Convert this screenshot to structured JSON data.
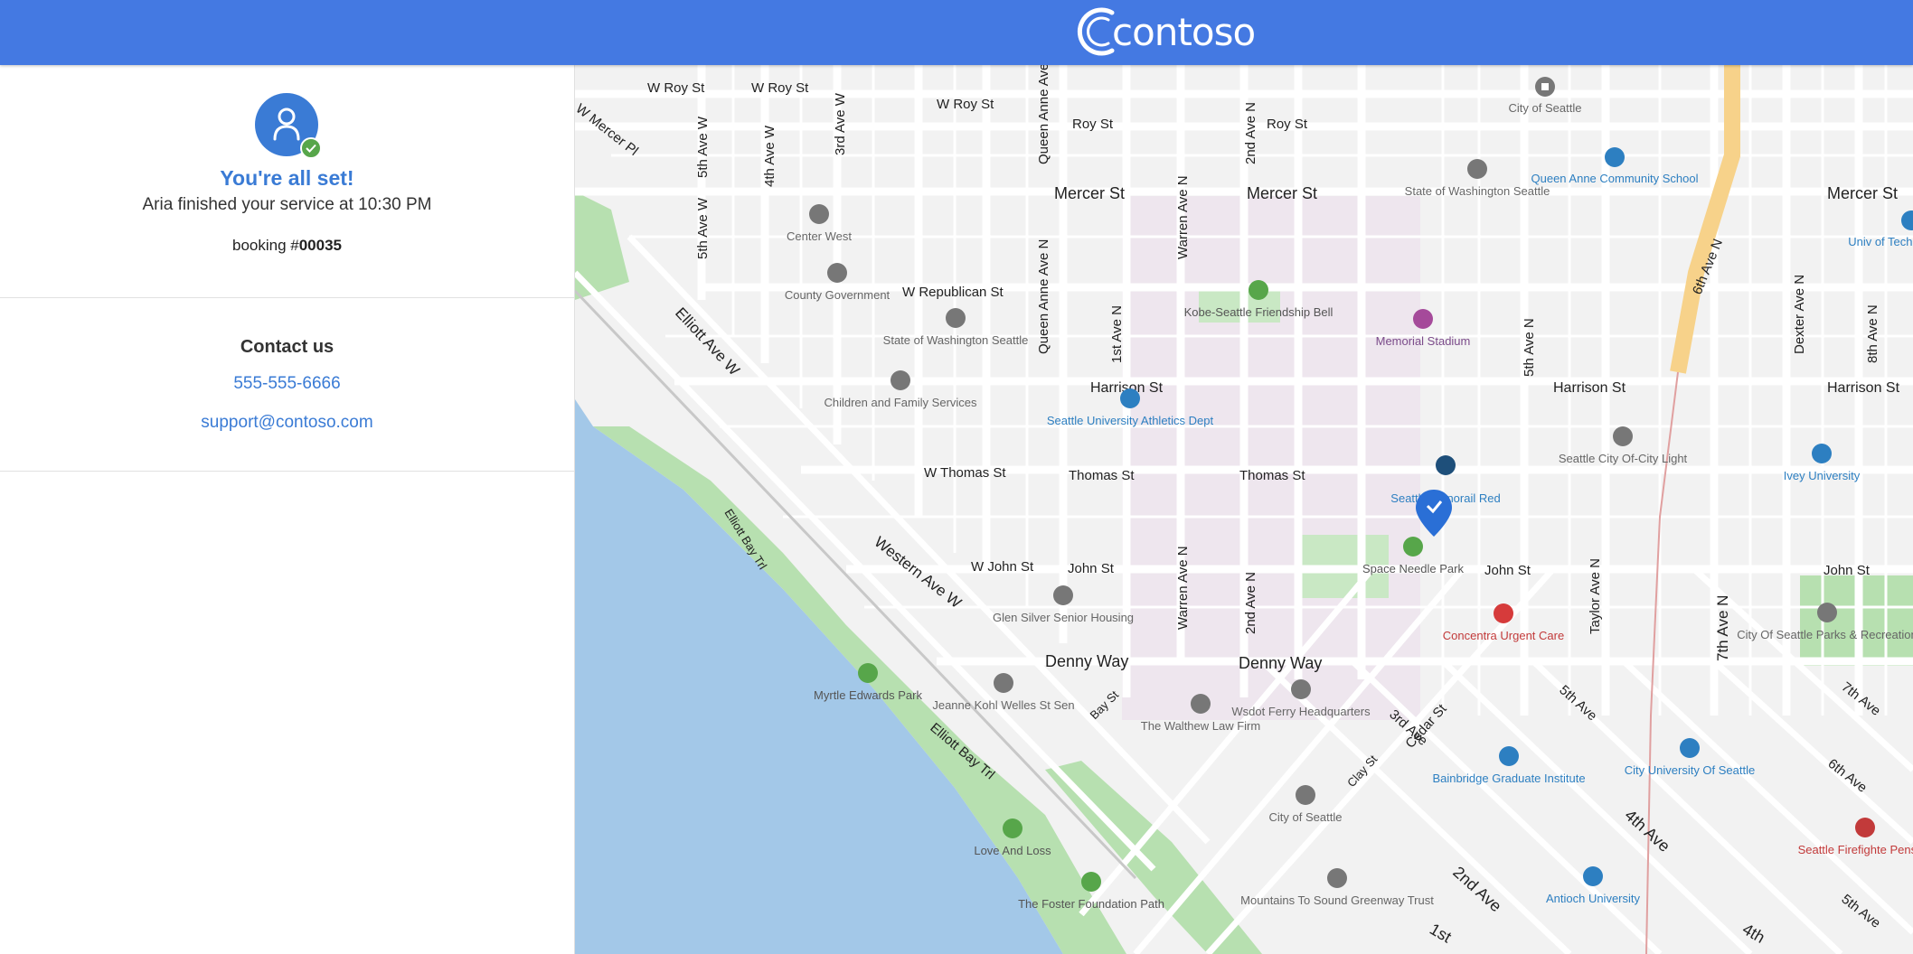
{
  "header": {
    "brand": "contoso",
    "brand_color": "#4479e2",
    "logo_icon": "contoso-logo-icon"
  },
  "status": {
    "avatar_icon": "person-icon",
    "badge_icon": "check-icon",
    "title": "You're all set!",
    "message": "Aria finished your service at 10:30 PM",
    "booking_prefix": "booking #",
    "booking_number": "00035"
  },
  "contact": {
    "title": "Contact us",
    "phone": "555-555-6666",
    "email": "support@contoso.com"
  },
  "map": {
    "streets": [
      "W Roy St",
      "W Roy St",
      "W Roy St",
      "Roy St",
      "Roy St",
      "W Mercer Pl",
      "Mercer St",
      "Mercer St",
      "Mercer St",
      "5th Ave W",
      "5th Ave W",
      "4th Ave W",
      "3rd Ave W",
      "Queen Anne Ave N",
      "Queen Anne Ave N",
      "Warren Ave N",
      "Warren Ave N",
      "2nd Ave N",
      "2nd Ave N",
      "1st Ave N",
      "5th Ave N",
      "6th Ave N",
      "Dexter Ave N",
      "8th Ave N",
      "Taylor Ave N",
      "7th Ave N",
      "W Republican St",
      "Harrison St",
      "Harrison St",
      "Harrison St",
      "W Thomas St",
      "Thomas St",
      "Thomas St",
      "W John St",
      "John St",
      "John St",
      "John St",
      "Denny Way",
      "Denny Way",
      "Elliott Ave W",
      "Western Ave W",
      "Elliott Bay Trl",
      "Elliott Bay Trl",
      "Bay St",
      "Clay St",
      "3rd Ave",
      "Cedar St",
      "5th Ave",
      "4th Ave",
      "2nd Ave",
      "1st",
      "4th",
      "7th Ave",
      "6th Ave",
      "5th Ave"
    ],
    "places": [
      {
        "name": "City of Seattle",
        "kind": "building"
      },
      {
        "name": "Queen Anne Community School",
        "kind": "school"
      },
      {
        "name": "State of Washington Seattle",
        "kind": "building"
      },
      {
        "name": "Center West",
        "kind": "building"
      },
      {
        "name": "County Government",
        "kind": "building"
      },
      {
        "name": "State of Washington Seattle",
        "kind": "building"
      },
      {
        "name": "Children and Family Services",
        "kind": "building"
      },
      {
        "name": "Kobe-Seattle Friendship Bell",
        "kind": "park"
      },
      {
        "name": "Memorial Stadium",
        "kind": "stadium"
      },
      {
        "name": "Seattle University Athletics Dept",
        "kind": "school"
      },
      {
        "name": "Seattle City Of-City Light",
        "kind": "building"
      },
      {
        "name": "Ivey University",
        "kind": "school"
      },
      {
        "name": "Seattle Monorail Red",
        "kind": "transit"
      },
      {
        "name": "Space Needle Park",
        "kind": "park"
      },
      {
        "name": "Concentra Urgent Care",
        "kind": "hospital"
      },
      {
        "name": "City Of Seattle Parks & Recreation",
        "kind": "building"
      },
      {
        "name": "Glen Silver Senior Housing",
        "kind": "building"
      },
      {
        "name": "Myrtle Edwards Park",
        "kind": "park"
      },
      {
        "name": "Jeanne Kohl Welles St Sen",
        "kind": "building"
      },
      {
        "name": "The Walthew Law Firm",
        "kind": "building"
      },
      {
        "name": "Wsdot Ferry Headquarters",
        "kind": "building"
      },
      {
        "name": "Bainbridge Graduate Institute",
        "kind": "school"
      },
      {
        "name": "City University Of Seattle",
        "kind": "school"
      },
      {
        "name": "City of Seattle",
        "kind": "building"
      },
      {
        "name": "Love And Loss",
        "kind": "park"
      },
      {
        "name": "The Foster Foundation Path",
        "kind": "park"
      },
      {
        "name": "Mountains To Sound Greenway Trust",
        "kind": "building"
      },
      {
        "name": "Antioch University",
        "kind": "school"
      },
      {
        "name": "Seattle Firefighte Pension",
        "kind": "fire"
      },
      {
        "name": "Univ of Tech S",
        "kind": "school"
      }
    ],
    "location_pin": "location-pin-icon",
    "colors": {
      "water": "#a3c8e8",
      "park": "#b7e0b0",
      "campus": "#eee6ee",
      "road": "#ffffff",
      "highway": "#f7d28a"
    }
  }
}
